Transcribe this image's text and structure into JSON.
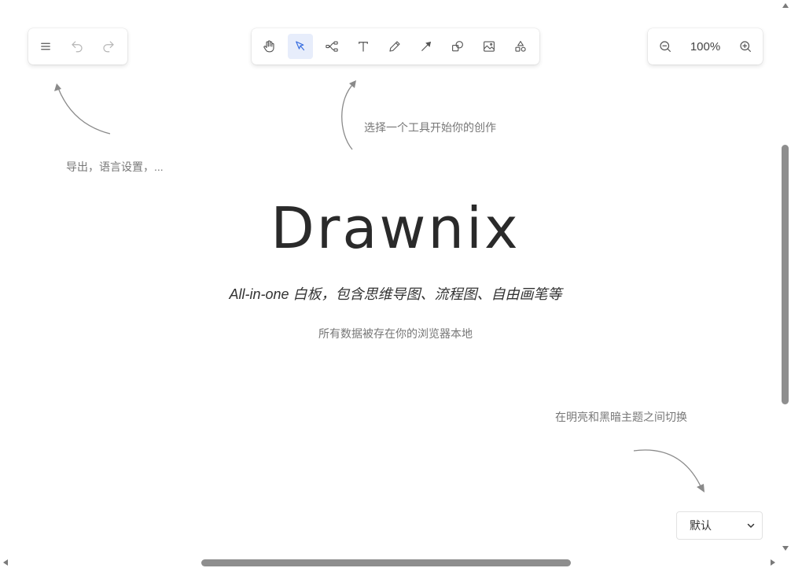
{
  "app_menu": {
    "menu_icon": "hamburger-menu-icon",
    "undo_icon": "undo-icon",
    "redo_icon": "redo-icon"
  },
  "toolbar": {
    "active_tool": "selection",
    "tools": [
      "hand-icon",
      "pointer-icon",
      "mind-map-icon",
      "text-icon",
      "pen-icon",
      "arrow-line-icon",
      "shapes-icon",
      "image-icon",
      "extra-shapes-icon"
    ]
  },
  "zoom": {
    "value": "100%",
    "zoom_out_icon": "zoom-out-icon",
    "zoom_in_icon": "zoom-in-icon"
  },
  "hints": {
    "menu_hint": "导出，语言设置，...",
    "toolbar_hint": "选择一个工具开始你的创作",
    "theme_hint": "在明亮和黑暗主题之间切换"
  },
  "welcome": {
    "brand": "Drawnix",
    "tagline": "All-in-one 白板，包含思维导图、流程图、自由画笔等",
    "storage_note": "所有数据被存在你的浏览器本地"
  },
  "theme": {
    "selected": "默认"
  },
  "colors": {
    "active_tool_bg": "#e7edfb",
    "active_tool_fg": "#3a6fe0",
    "hint_text": "#777777"
  }
}
